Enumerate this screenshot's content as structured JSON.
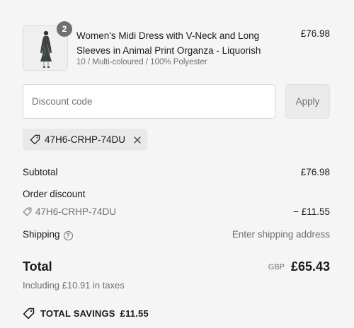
{
  "product": {
    "quantity": "2",
    "title": "Women's Midi Dress with V-Neck and Long Sleeves in Animal Print Organza - Liquorish",
    "variant": "10 / Multi-coloured / 100% Polyester",
    "price": "£76.98"
  },
  "discount": {
    "placeholder": "Discount code",
    "apply_label": "Apply",
    "applied_code": "47H6-CRHP-74DU"
  },
  "summary": {
    "subtotal_label": "Subtotal",
    "subtotal_value": "£76.98",
    "order_discount_label": "Order discount",
    "discount_code": "47H6-CRHP-74DU",
    "discount_value": "− £11.55",
    "shipping_label": "Shipping",
    "shipping_value": "Enter shipping address"
  },
  "total": {
    "label": "Total",
    "currency": "GBP",
    "amount": "£65.43",
    "taxes_note": "Including £10.91 in taxes"
  },
  "savings": {
    "label": "TOTAL SAVINGS",
    "amount": "£11.55"
  },
  "icons": {
    "tag": "tag-icon",
    "close": "close-icon",
    "info": "info-icon"
  }
}
